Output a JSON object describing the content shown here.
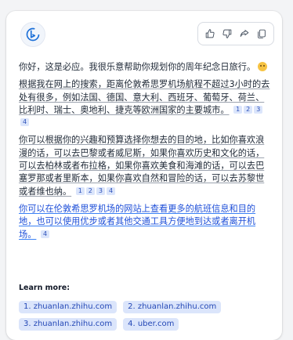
{
  "message": {
    "greeting": "你好，这是必应。我很乐意帮助你规划你的周年纪念日旅行。",
    "para1": "根据我在网上的搜索，距离伦敦希思罗机场航程不超过3小时的去处有很多，例如法国、德国、意大利、西班牙、葡萄牙、荷兰、比利时、瑞士、奥地利、捷克等欧洲国家的主要城市。",
    "para1_cites": [
      "1",
      "2",
      "3",
      "4"
    ],
    "para2": "你可以根据你的兴趣和预算选择你想去的目的地，比如你喜欢浪漫的话，可以去巴黎或者威尼斯，如果你喜欢历史和文化的话，可以去柏林或者布拉格，如果你喜欢美食和海滩的话，可以去巴塞罗那或者里斯本，如果你喜欢自然和冒险的话，可以去苏黎世或者维也纳。",
    "para2_cites": [
      "1",
      "2",
      "3",
      "4"
    ],
    "para3": "你可以在伦敦希思罗机场的网站上查看更多的航班信息和目的地，也可以使用优步或者其他交通工具方便地到达或者离开机场。",
    "para3_cites": [
      "4"
    ]
  },
  "learn_more": {
    "label": "Learn more:",
    "links": [
      "1. zhuanlan.zhihu.com",
      "2. zhuanlan.zhihu.com",
      "3. zhuanlan.zhihu.com",
      "4. uber.com"
    ]
  },
  "colors": {
    "accent": "#2448b6",
    "chip_bg": "#dbe5fb"
  },
  "icons": [
    "bing-logo-icon",
    "thumbs-up-icon",
    "thumbs-down-icon",
    "share-icon",
    "copy-icon"
  ]
}
